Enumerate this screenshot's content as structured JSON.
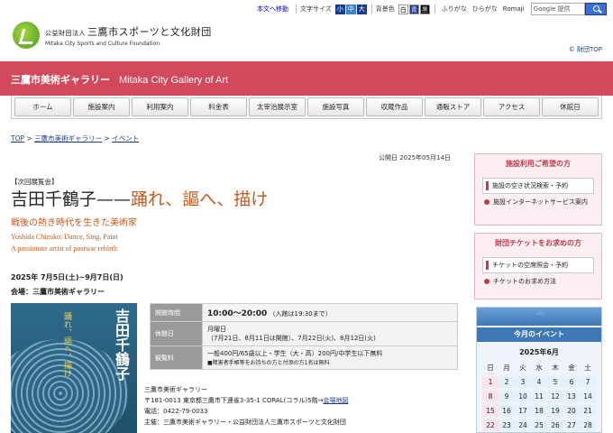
{
  "utility": {
    "skip_label": "本文へ移動",
    "text_size_label": "文字サイズ",
    "sizes": [
      "小",
      "中",
      "大"
    ],
    "bg_label": "背景色",
    "bg_options": [
      "白",
      "青",
      "黒"
    ],
    "furigana": "ふりがな",
    "hiragana": "ひらがな",
    "romaji": "Romaji",
    "search_placeholder": "Google 提供"
  },
  "header": {
    "org_prefix": "公益財団法人",
    "org_name": "三鷹市スポーツと文化財団",
    "org_en": "Mitaka City Sports and Culture Foundation",
    "foundation_top": "© 財団TOP"
  },
  "band": {
    "title_ja": "三鷹市美術ギャラリー",
    "title_en": "Mitaka City Gallery of Art"
  },
  "nav": {
    "items": [
      "ホーム",
      "施設案内",
      "利用案内",
      "料金表",
      "太宰治展示室",
      "施設写真",
      "収蔵作品",
      "通販ストア",
      "アクセス",
      "休館日"
    ]
  },
  "breadcrumb": {
    "top": "TOP",
    "gallery": "三鷹市美術ギャラリー",
    "current": "イベント",
    "sep": ">"
  },
  "article": {
    "published": "公開日 2025年05月14日",
    "tag": "【次回展覧会】",
    "title_name": "吉田千鶴子",
    "title_dash": "——",
    "title_sub": "踊れ、謳へ、描け",
    "subtitle": "戦後の熱き時代を生きた美術家",
    "en_line1": "Yoshida Chizuko: Dance, Sing, Paint",
    "en_line2": "A passionate artist of postwar rebirth",
    "dates": "2025年 7月5日(土)~9月7日(日)",
    "venue": "会場：三鷹市美術ギャラリー",
    "poster_title": "吉田千鶴子",
    "poster_sub": "踊れ、謳へ、描け"
  },
  "info_table": {
    "hours_label": "開館時間",
    "hours_value": "10:00～20:00",
    "hours_note": "（入館は19:30まで）",
    "closed_label": "休館日",
    "closed_line1": "月曜日",
    "closed_line2": "（7月21日、8月11日は開館）、7月22日(火)、8月12日(火)",
    "fee_label": "観覧料",
    "fee_line1": "一般400円/65歳以上・学生（大・高）200円/中学生以下無料",
    "fee_line2": "■障害者手帳等をお持ちの方と付添の方1名は無料"
  },
  "address": {
    "name": "三鷹市美術ギャラリー",
    "line": "〒181-0013 東京都三鷹市下連雀3-35-1 CORAL(コラル)5階→",
    "map_link": "会場地図",
    "phone": "電話：0422-79-0033",
    "organizer": "主催：三鷹市美術ギャラリー・公益財団法人三鷹市スポーツと文化財団"
  },
  "sidebar": {
    "facility_header": "施設利用ご希望の方",
    "facility_btn": "施設の空き状況検索・予約",
    "facility_link": "施設インターネットサービス案内",
    "ticket_header": "財団チケットをお求めの方",
    "ticket_btn": "チケットの空席照会・予約",
    "ticket_link": "チケットのお求め方法"
  },
  "calendar": {
    "header": "今月のイベント",
    "month": "2025年6月",
    "weekdays": [
      "日",
      "月",
      "火",
      "水",
      "木",
      "金",
      "土"
    ],
    "rows": [
      [
        "1",
        "2",
        "3",
        "4",
        "5",
        "6",
        "7"
      ],
      [
        "8",
        "9",
        "10",
        "11",
        "12",
        "13",
        "14"
      ],
      [
        "15",
        "16",
        "17",
        "18",
        "19",
        "20",
        "21"
      ],
      [
        "22",
        "23",
        "24",
        "25",
        "26",
        "27",
        "28"
      ]
    ]
  }
}
